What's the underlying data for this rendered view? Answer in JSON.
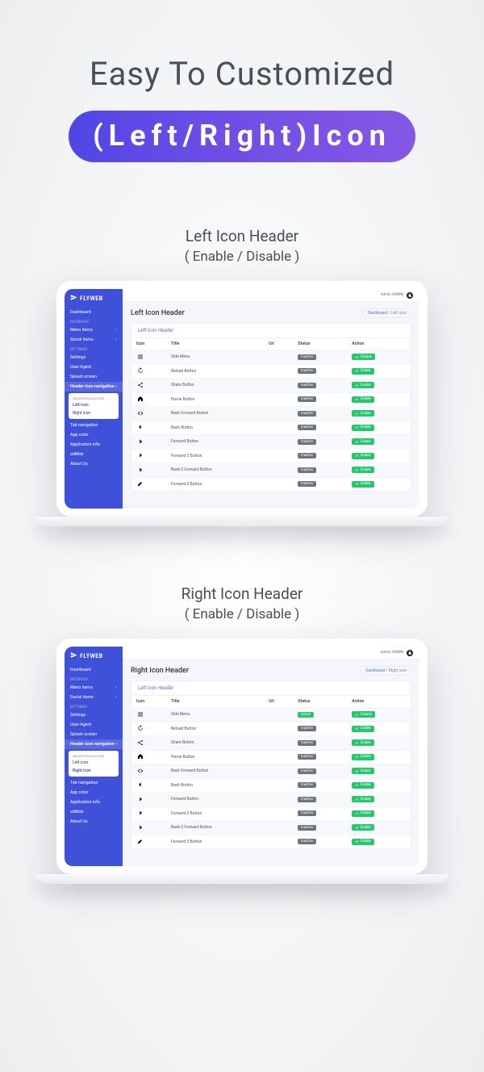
{
  "hero": {
    "title": "Easy To Customized",
    "pill": "(Left/Right)Icon"
  },
  "section1": {
    "title": "Left Icon Header",
    "subtitle": "( Enable / Disable )"
  },
  "section2": {
    "title": "Right Icon Header",
    "subtitle": "( Enable / Disable )"
  },
  "dash": {
    "brand": "FLYWEB",
    "user": "Admin ADMIN",
    "sec_interface": "INTERFACE",
    "sec_settings": "SETTINGS",
    "menu": {
      "dashboard": "Dashboard",
      "menu_items": "Menu items",
      "social_items": "Social items",
      "settings": "Settings",
      "user_agent": "User-Agent",
      "splash": "Splash screen",
      "header_nav": "Header icon navigation",
      "tab_nav": "Tab navigation",
      "app_color": "App color",
      "app_info": "Application info",
      "admob": "adMob",
      "about": "About Us"
    },
    "sub_header": "HEADER NAVIGATION",
    "sub_left": "Left icon",
    "sub_right": "Right icon",
    "crumb_root": "Dashboard",
    "crumb_l": "Left icon",
    "crumb_r": "Right icon",
    "page_l": "Left Icon Header",
    "page_r": "Right Icon Header",
    "card_title": "Left Icon Header",
    "cols": {
      "icon": "Icon",
      "title": "Title",
      "url": "Url",
      "status": "Status",
      "action": "Action"
    },
    "status_active": "Active",
    "status_inactive": "Inactive",
    "btn_enable": "Enable",
    "btn_disable": "Disable",
    "rows_left": [
      {
        "icon": "menu",
        "title": "Side Menu",
        "status": "off",
        "action": "disable",
        "hi": true
      },
      {
        "icon": "reload",
        "title": "Reload Button",
        "status": "off",
        "action": "enable"
      },
      {
        "icon": "share",
        "title": "Share Button",
        "status": "off",
        "action": "enable",
        "hi": true
      },
      {
        "icon": "home",
        "title": "Home Button",
        "status": "off",
        "action": "enable"
      },
      {
        "icon": "backforward",
        "title": "Back Forward Button",
        "status": "off",
        "action": "enable",
        "hi": true
      },
      {
        "icon": "back",
        "title": "Back Button",
        "status": "off",
        "action": "enable"
      },
      {
        "icon": "forward",
        "title": "Forward Button",
        "status": "off",
        "action": "enable",
        "hi": true
      },
      {
        "icon": "forward",
        "title": "Forward-2 Button",
        "status": "off",
        "action": "enable"
      },
      {
        "icon": "forward",
        "title": "Back-2 Forward Button",
        "status": "off",
        "action": "enable",
        "hi": true
      },
      {
        "icon": "edit",
        "title": "Forward-3 Button",
        "status": "off",
        "action": "enable"
      }
    ],
    "rows_right": [
      {
        "icon": "menu",
        "title": "Side Menu",
        "status": "on",
        "action": "disable",
        "hi": true
      },
      {
        "icon": "reload",
        "title": "Reload Button",
        "status": "off",
        "action": "enable"
      },
      {
        "icon": "share",
        "title": "Share Button",
        "status": "off",
        "action": "enable",
        "hi": true
      },
      {
        "icon": "home",
        "title": "Home Button",
        "status": "off",
        "action": "enable"
      },
      {
        "icon": "backforward",
        "title": "Back Forward Button",
        "status": "off",
        "action": "enable",
        "hi": true
      },
      {
        "icon": "back",
        "title": "Back Button",
        "status": "off",
        "action": "enable"
      },
      {
        "icon": "forward",
        "title": "Forward Button",
        "status": "off",
        "action": "enable",
        "hi": true
      },
      {
        "icon": "forward",
        "title": "Forward-2 Button",
        "status": "off",
        "action": "enable"
      },
      {
        "icon": "forward",
        "title": "Back-2 Forward Button",
        "status": "off",
        "action": "enable",
        "hi": true
      },
      {
        "icon": "edit",
        "title": "Forward-3 Button",
        "status": "off",
        "action": "enable"
      }
    ]
  }
}
